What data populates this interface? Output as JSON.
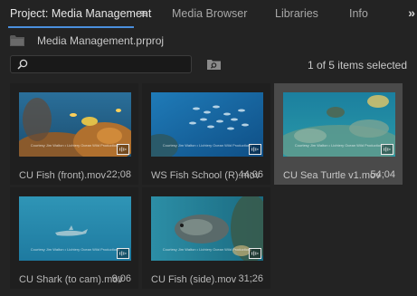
{
  "tabs": [
    {
      "label": "Project: Media Management",
      "active": true
    },
    {
      "label": "Media Browser",
      "active": false
    },
    {
      "label": "Libraries",
      "active": false
    },
    {
      "label": "Info",
      "active": false
    }
  ],
  "tab_menu_glyph": "≡",
  "tab_overflow_glyph": "»",
  "project": {
    "filename": "Media Management.prproj",
    "icon": "folder-icon"
  },
  "search": {
    "value": "",
    "placeholder": ""
  },
  "status": {
    "selection": "1 of 5 items selected"
  },
  "colors": {
    "accent": "#4b8fdd",
    "selected_tile": "#4a4a4a"
  },
  "clips": [
    {
      "name": "CU Fish (front).mov",
      "duration": "22;08",
      "selected": false,
      "watermark": "Courtesy Jim Walton • Lichtery Ocean Wild Productions",
      "scene": "fish-coral"
    },
    {
      "name": "WS Fish School (R).mov",
      "duration": "44;06",
      "selected": false,
      "watermark": "Courtesy Jim Walton • Lichtery Ocean Wild Productions",
      "scene": "fish-school"
    },
    {
      "name": "CU Sea Turtle v1.mov",
      "duration": "54;04",
      "selected": true,
      "watermark": "Courtesy Jim Walton • Lichtery Ocean Wild Productions",
      "scene": "sea-turtle"
    },
    {
      "name": "CU Shark (to cam).mov",
      "duration": "9;06",
      "selected": false,
      "watermark": "Courtesy Jim Walton • Lichtery Ocean Wild Productions",
      "scene": "shark"
    },
    {
      "name": "CU Fish (side).mov",
      "duration": "31;26",
      "selected": false,
      "watermark": "Courtesy Jim Walton • Lichtery Ocean Wild Productions",
      "scene": "fish-side"
    }
  ]
}
